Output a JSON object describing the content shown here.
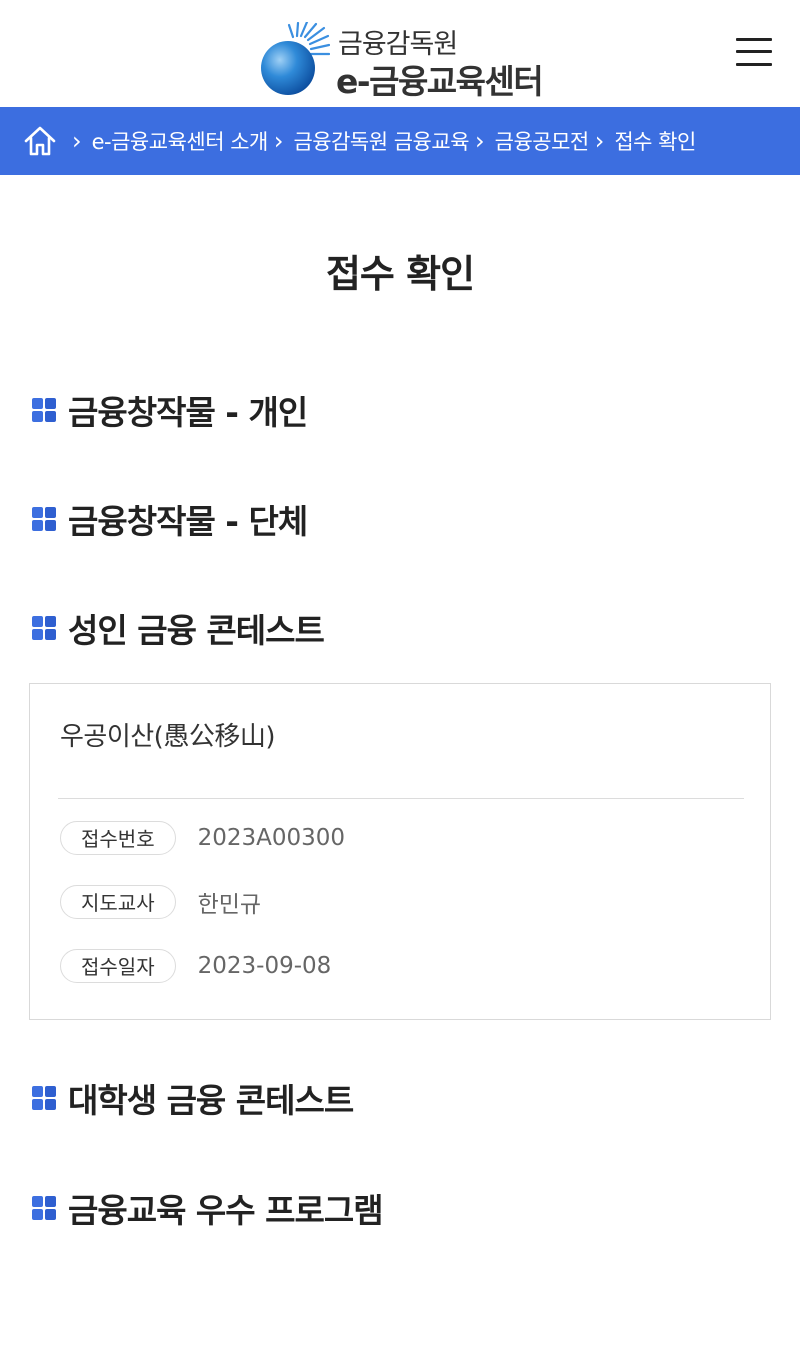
{
  "header": {
    "logo_top": "금융감독원",
    "logo_bottom": "e-금융교육센터",
    "menu_icon": "hamburger-menu-icon"
  },
  "breadcrumb": {
    "home_icon": "home-icon",
    "items": [
      "e-금융교육센터 소개",
      "금융감독원 금융교육",
      "금융공모전",
      "접수 확인"
    ]
  },
  "page": {
    "title": "접수 확인"
  },
  "sections": [
    {
      "title": "금융창작물 - 개인"
    },
    {
      "title": "금융창작물 - 단체"
    },
    {
      "title": "성인 금융 콘테스트"
    },
    {
      "title": "대학생 금융 콘테스트"
    },
    {
      "title": "금융교육 우수 프로그램"
    }
  ],
  "entry": {
    "title": "우공이산(愚公移山)",
    "fields": [
      {
        "label": "접수번호",
        "value": "2023A00300"
      },
      {
        "label": "지도교사",
        "value": "한민규"
      },
      {
        "label": "접수일자",
        "value": "2023-09-08"
      }
    ]
  },
  "colors": {
    "brand_blue": "#3c6ee0",
    "bullet_blue": "#3d6fe0"
  }
}
